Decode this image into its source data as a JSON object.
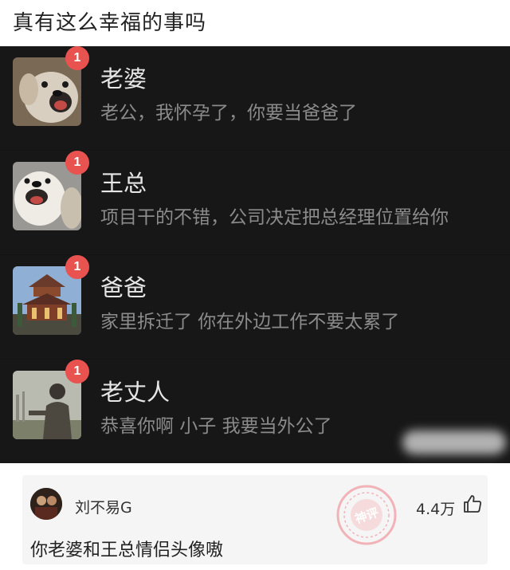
{
  "title": "真有这么幸福的事吗",
  "chats": [
    {
      "name": "老婆",
      "message": "老公，我怀孕了，你要当爸爸了",
      "badge": "1",
      "avatar_icon": "dog-avatar-icon"
    },
    {
      "name": "王总",
      "message": "项目干的不错，公司决定把总经理位置给你",
      "badge": "1",
      "avatar_icon": "dog-avatar-icon"
    },
    {
      "name": "爸爸",
      "message": "家里拆迁了 你在外边工作不要太累了",
      "badge": "1",
      "avatar_icon": "pagoda-avatar-icon"
    },
    {
      "name": "老丈人",
      "message": "恭喜你啊 小子 我要当外公了",
      "badge": "1",
      "avatar_icon": "man-avatar-icon"
    }
  ],
  "comment": {
    "username": "刘不易G",
    "text": "你老婆和王总情侣头像嗷",
    "likes": "4.4万",
    "like_icon": "thumbs-up-icon",
    "stamp_text": "神评"
  },
  "colors": {
    "badge": "#e8524f",
    "chat_bg": "#171717",
    "comment_bg": "#f5f5f5"
  }
}
